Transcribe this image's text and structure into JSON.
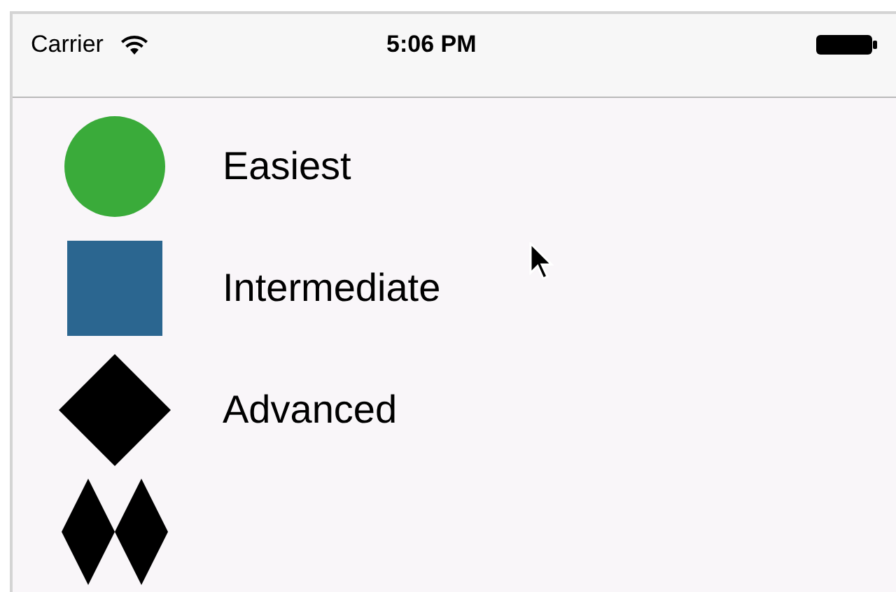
{
  "status_bar": {
    "carrier": "Carrier",
    "time": "5:06 PM"
  },
  "rows": [
    {
      "kind": "circle",
      "label": "Easiest"
    },
    {
      "kind": "square",
      "label": "Intermediate"
    },
    {
      "kind": "diamond",
      "label": "Advanced"
    },
    {
      "kind": "double_diamond"
    }
  ]
}
